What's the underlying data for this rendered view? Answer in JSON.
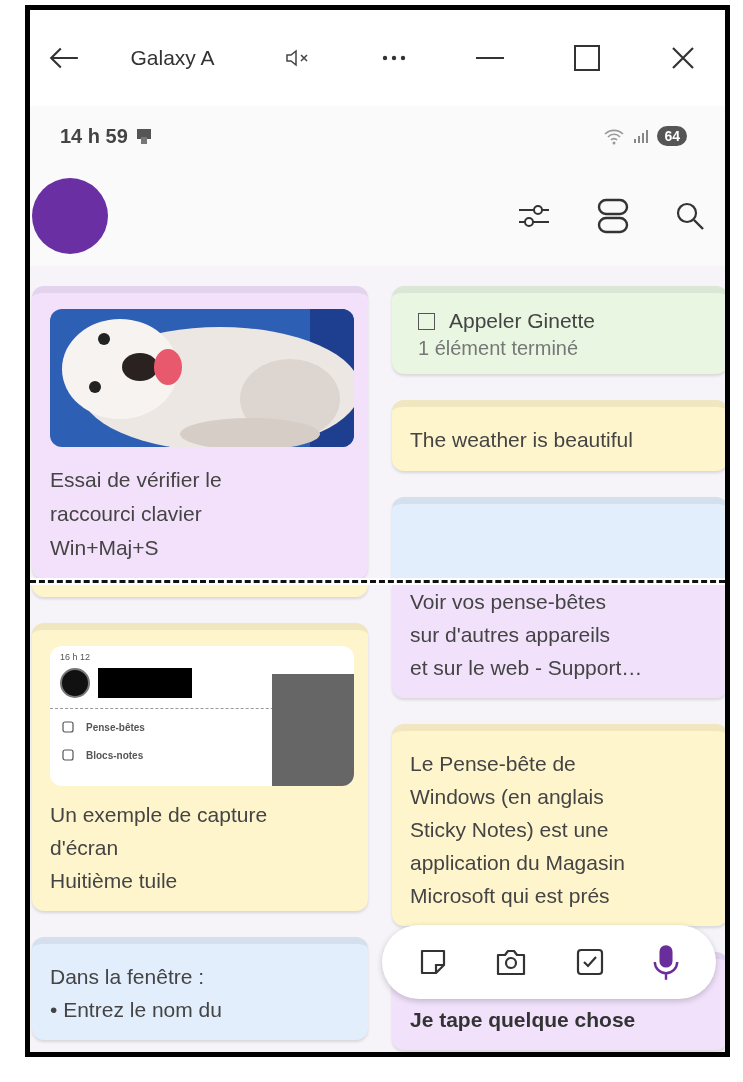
{
  "window": {
    "title": "Galaxy A"
  },
  "status_bar": {
    "time": "14 h 59",
    "battery": "64"
  },
  "top_columns": [
    [
      {
        "kind": "image_text",
        "color": "#f3e1fb",
        "lines": [
          "Essai de vérifier le",
          "raccourci clavier",
          "Win+Maj+S"
        ]
      }
    ],
    [
      {
        "kind": "checklist",
        "color": "#e8f6e2",
        "items": [
          {
            "label": "Appeler Ginette",
            "checked": false
          }
        ],
        "summary": "1 élément terminé"
      },
      {
        "kind": "text",
        "color": "#fff5cc",
        "lines": [
          "The weather is beautiful"
        ]
      },
      {
        "kind": "blank",
        "color": "#e3eefd"
      }
    ]
  ],
  "bottom_columns": [
    [
      {
        "kind": "stub",
        "color": "#fff5cc"
      },
      {
        "kind": "screenshot_text",
        "color": "#fff5cc",
        "shot": {
          "time": "16 h 12",
          "items": [
            "Pense-bêtes",
            "Blocs-notes"
          ]
        },
        "lines": [
          "Un exemple de capture",
          "d'écran",
          "Huitième tuile"
        ]
      },
      {
        "kind": "text",
        "color": "#e3eefd",
        "lines": [
          "Dans la fenêtre :",
          "• Entrez le nom du"
        ]
      }
    ],
    [
      {
        "kind": "text",
        "color": "#f1e1fb",
        "lines": [
          "Voir vos pense-bêtes",
          "sur d'autres appareils",
          "et sur le web - Support…"
        ]
      },
      {
        "kind": "text",
        "color": "#fff5cc",
        "lines": [
          "Le Pense-bête de",
          "Windows (en anglais",
          "Sticky Notes) est une",
          "application du Magasin",
          "Microsoft qui est prés"
        ]
      },
      {
        "kind": "bold",
        "color": "#f1e1fb",
        "lines": [
          "Je tape quelque chose"
        ]
      }
    ]
  ]
}
